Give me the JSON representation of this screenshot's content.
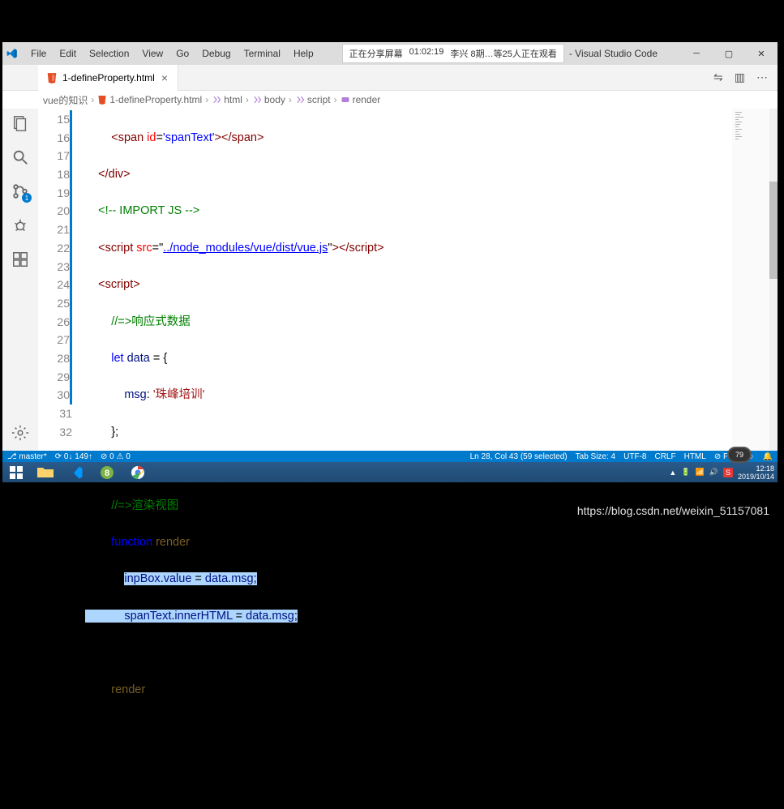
{
  "titlebar": {
    "menu": [
      "File",
      "Edit",
      "Selection",
      "View",
      "Go",
      "Debug",
      "Terminal",
      "Help"
    ],
    "share_status": "正在分享屏幕",
    "share_time": "01:02:19",
    "share_viewers": "李兴 8期…等25人正在观看",
    "title_suffix": "- Visual Studio Code"
  },
  "tab": {
    "name": "1-defineProperty.html"
  },
  "tabs_actions": {
    "compare": "⇋",
    "split": "▥",
    "more": "⋯"
  },
  "breadcrumbs": [
    {
      "label": "vue的知识",
      "icon": ""
    },
    {
      "label": "1-defineProperty.html",
      "icon": "file"
    },
    {
      "label": "html",
      "icon": "tag"
    },
    {
      "label": "body",
      "icon": "tag"
    },
    {
      "label": "script",
      "icon": "tag"
    },
    {
      "label": "render",
      "icon": "cube"
    }
  ],
  "activity_badge": "1",
  "line_numbers": [
    "15",
    "16",
    "17",
    "18",
    "19",
    "20",
    "21",
    "22",
    "23",
    "24",
    "25",
    "26",
    "27",
    "28",
    "29",
    "30",
    "31",
    "32"
  ],
  "code": {
    "l15a": "<",
    "l15b": "span",
    "l15c": " id",
    "l15d": "=",
    "l15e": "'spanText'",
    "l15f": "></",
    "l15g": "span",
    "l15h": ">",
    "l16a": "</",
    "l16b": "div",
    "l16c": ">",
    "l17a": "<!-- IMPORT JS -->",
    "l18a": "<",
    "l18b": "script",
    "l18c": " src",
    "l18d": "=\"",
    "l18e": "../node_modules/vue/dist/vue.js",
    "l18f": "\"",
    "l18g": "></",
    "l18h": "script",
    "l18i": ">",
    "l19a": "<",
    "l19b": "script",
    "l19c": ">",
    "l20a": "//=>",
    "l20b": "响应式数据",
    "l21a": "let",
    "l21b": " data ",
    "l21c": "=",
    "l21d": " {",
    "l22a": "msg",
    "l22b": ": ",
    "l22c": "'珠峰培训'",
    "l23a": "};",
    "l25a": "//=>",
    "l25b": "渲染视图",
    "l26a": "function",
    "l26b": " ",
    "l26c": "render",
    "l26d": "() {",
    "l27a": "inpBox",
    "l27b": ".",
    "l27c": "value",
    "l27d": " = ",
    "l27e": "data",
    "l27f": ".",
    "l27g": "msg",
    "l27h": ";",
    "l28a": "spanText",
    "l28b": ".",
    "l28c": "innerHTML",
    "l28d": " = ",
    "l28e": "data",
    "l28f": ".",
    "l28g": "msg",
    "l28h": ";",
    "l29a": "}",
    "l30a": "render",
    "l30b": "();"
  },
  "statusbar": {
    "branch": "master*",
    "sync": "⟳ 0↓ 149↑",
    "problems": "⊘ 0 ⚠ 0",
    "position": "Ln 28, Col 43 (59 selected)",
    "tabsize": "Tab Size: 4",
    "encoding": "UTF-8",
    "eol": "CRLF",
    "lang": "HTML",
    "port": "⊘ Port",
    "feedback": "☺",
    "bell": "🔔"
  },
  "taskbar": {
    "time": "12:18",
    "date": "2019/10/14"
  },
  "battery_overlay": "79",
  "watermark": "https://blog.csdn.net/weixin_51157081"
}
